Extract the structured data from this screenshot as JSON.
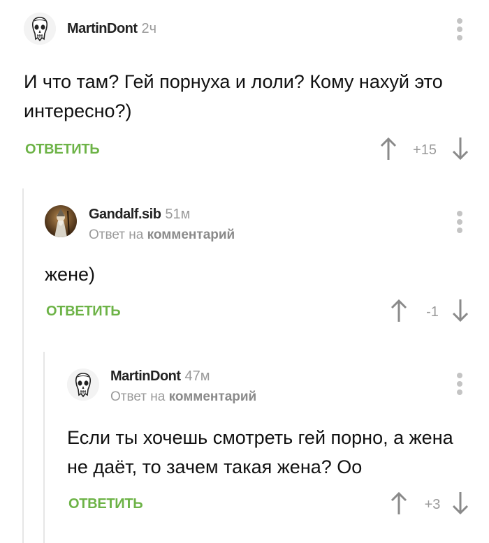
{
  "comments": [
    {
      "author": "MartinDont",
      "time": "2ч",
      "reply_prefix": "",
      "reply_link": "",
      "text": "И что там? Гей порнуха и лоли? Кому нахуй это интересно?)",
      "reply_label": "ОТВЕТИТЬ",
      "rating": "+15",
      "avatar_icon": "skull-avatar-icon"
    },
    {
      "author": "Gandalf.sib",
      "time": "51м",
      "reply_prefix": "Ответ на",
      "reply_link": "комментарий",
      "text": "жене)",
      "reply_label": "ОТВЕТИТЬ",
      "rating": "-1",
      "avatar_icon": "gandalf-avatar-icon"
    },
    {
      "author": "MartinDont",
      "time": "47м",
      "reply_prefix": "Ответ на",
      "reply_link": "комментарий",
      "text": "Если ты хочешь смотреть гей порно, а жена не даёт, то зачем такая жена? Оо",
      "reply_label": "ОТВЕТИТЬ",
      "rating": "+3",
      "avatar_icon": "skull-avatar-icon"
    }
  ],
  "colors": {
    "accent_green": "#6db347",
    "muted_gray": "#9a9a9a",
    "thread_line": "#e6e6e6"
  }
}
